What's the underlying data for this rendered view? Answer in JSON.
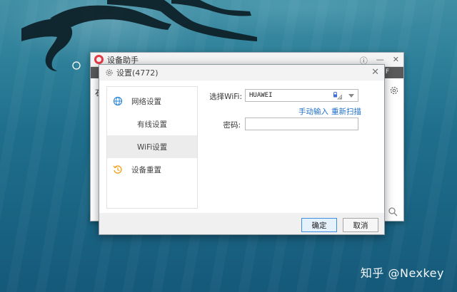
{
  "wallpaper": {
    "watermark": "知乎 @Nexkey"
  },
  "main_window": {
    "title": "设备助手",
    "title_buttons": [
      "ⓘ",
      "—",
      "✕"
    ],
    "toolbar_tail": "F",
    "left_char": "石"
  },
  "dialog": {
    "title": "设置(4772)",
    "close": "✕",
    "nav": {
      "network": "网络设置",
      "wired": "有线设置",
      "wifi": "WiFi设置",
      "reset": "设备重置"
    },
    "wifi_form": {
      "select_label": "选择WiFi:",
      "selected_network": "HUAWEI",
      "manual_link": "手动输入",
      "rescan_link": "重新扫描",
      "password_label": "密码:",
      "password_value": ""
    },
    "buttons": {
      "ok": "确定",
      "cancel": "取消"
    }
  },
  "colors": {
    "accent": "#1f6fc9",
    "ok_border": "#3d8ee0",
    "brand": "#e23b47",
    "ocean": "#1f6f8c"
  },
  "icons": [
    "globe-icon",
    "history-icon",
    "gear-icon",
    "lock-icon",
    "wifi-icon",
    "search-icon",
    "info-icon",
    "close-icon"
  ]
}
